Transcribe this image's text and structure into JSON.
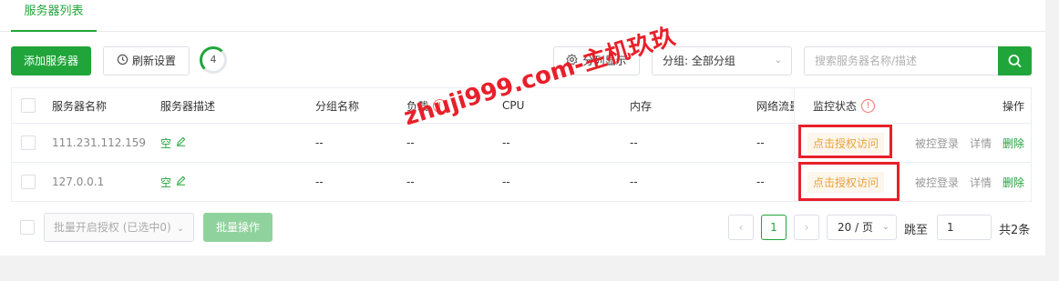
{
  "tabs": {
    "active": "服务器列表"
  },
  "toolbar": {
    "add_label": "添加服务器",
    "refresh_label": "刷新设置",
    "refresh_count": "4",
    "columns_label": "分列显示",
    "group_select": "分组: 全部分组",
    "search_placeholder": "搜索服务器名称/描述"
  },
  "table": {
    "headers": {
      "name": "服务器名称",
      "desc": "服务器描述",
      "group": "分组名称",
      "load": "负载",
      "cpu": "CPU",
      "mem": "内存",
      "net": "网络流量",
      "monitor": "监控状态",
      "ops": "操作"
    },
    "rows": [
      {
        "name": "111.231.112.159",
        "desc": "空",
        "group": "--",
        "load": "--",
        "cpu": "--",
        "mem": "--",
        "net": "--",
        "monitor": "点击授权访问",
        "op_login": "被控登录",
        "op_detail": "详情",
        "op_delete": "删除"
      },
      {
        "name": "127.0.0.1",
        "desc": "空",
        "group": "--",
        "load": "--",
        "cpu": "--",
        "mem": "--",
        "net": "--",
        "monitor": "点击授权访问",
        "op_login": "被控登录",
        "op_detail": "详情",
        "op_delete": "删除"
      }
    ]
  },
  "footer": {
    "batch_select": "批量开启授权 (已选中0)",
    "batch_action": "批量操作",
    "current_page": "1",
    "page_size": "20 / 页",
    "jump_label": "跳至",
    "jump_value": "1",
    "total": "共2条"
  },
  "watermark": "zhuji999.com-主机玖玖",
  "colors": {
    "accent": "#20a53a",
    "warning": "#e6a23c",
    "danger": "#f56c6c",
    "highlight": "#e8202a"
  }
}
